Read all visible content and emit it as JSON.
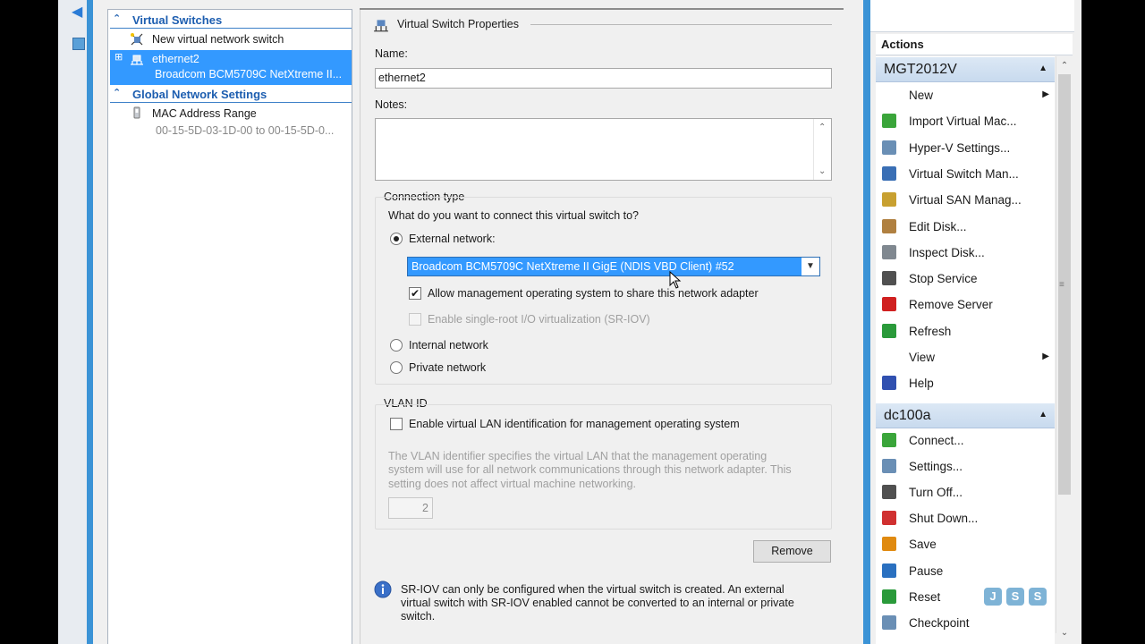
{
  "tree": {
    "sections": [
      {
        "label": "Virtual Switches"
      },
      {
        "label": "Global Network Settings"
      }
    ],
    "new_switch": "New virtual network switch",
    "switch": {
      "name": "ethernet2",
      "adapter": "Broadcom BCM5709C NetXtreme II..."
    },
    "mac": {
      "label": "MAC Address Range",
      "value": "00-15-5D-03-1D-00 to 00-15-5D-0..."
    }
  },
  "props": {
    "title": "Virtual Switch Properties",
    "name_label": "Name:",
    "name_value": "ethernet2",
    "notes_label": "Notes:",
    "connection": {
      "title": "Connection type",
      "question": "What do you want to connect this virtual switch to?",
      "external": "External network:",
      "adapter_selected": "Broadcom BCM5709C NetXtreme II GigE (NDIS VBD Client) #52",
      "allow_mgmt": "Allow management operating system to share this network adapter",
      "sriov": "Enable single-root I/O virtualization (SR-IOV)",
      "internal": "Internal network",
      "private": "Private network"
    },
    "vlan": {
      "title": "VLAN ID",
      "enable": "Enable virtual LAN identification for management operating system",
      "desc1": "The VLAN identifier specifies the virtual LAN that the management operating",
      "desc2": "system will use for all network communications through this network adapter. This",
      "desc3": "setting does not affect virtual machine networking.",
      "value": "2"
    },
    "remove_button": "Remove",
    "info1": "SR-IOV can only be configured when the virtual switch is created. An external",
    "info2": "virtual switch with SR-IOV enabled cannot be converted to an internal or private",
    "info3": "switch."
  },
  "actions": {
    "header": "Actions",
    "group1": {
      "title": "MGT2012V",
      "items": [
        {
          "label": "New",
          "icon": "none",
          "color": ""
        },
        {
          "label": "Import Virtual Mac...",
          "icon": "import-icon",
          "color": "#3aa53a"
        },
        {
          "label": "Hyper-V Settings...",
          "icon": "settings-icon",
          "color": "#6a8fb5"
        },
        {
          "label": "Virtual Switch Man...",
          "icon": "network-icon",
          "color": "#3a6fb5"
        },
        {
          "label": "Virtual SAN Manag...",
          "icon": "san-icon",
          "color": "#c8a030"
        },
        {
          "label": "Edit Disk...",
          "icon": "edit-disk-icon",
          "color": "#b08040"
        },
        {
          "label": "Inspect Disk...",
          "icon": "inspect-disk-icon",
          "color": "#808890"
        },
        {
          "label": "Stop Service",
          "icon": "stop-icon",
          "color": "#505050"
        },
        {
          "label": "Remove Server",
          "icon": "remove-icon",
          "color": "#d02020"
        },
        {
          "label": "Refresh",
          "icon": "refresh-icon",
          "color": "#2a9a3a"
        },
        {
          "label": "View",
          "icon": "none",
          "color": ""
        },
        {
          "label": "Help",
          "icon": "help-icon",
          "color": "#3050b0"
        }
      ]
    },
    "group2": {
      "title": "dc100a",
      "items": [
        {
          "label": "Connect...",
          "icon": "connect-icon",
          "color": "#3aa53a"
        },
        {
          "label": "Settings...",
          "icon": "settings-icon",
          "color": "#6a8fb5"
        },
        {
          "label": "Turn Off...",
          "icon": "turn-off-icon",
          "color": "#505050"
        },
        {
          "label": "Shut Down...",
          "icon": "shutdown-icon",
          "color": "#d03030"
        },
        {
          "label": "Save",
          "icon": "save-icon",
          "color": "#e08a10"
        },
        {
          "label": "Pause",
          "icon": "pause-icon",
          "color": "#2a70c0"
        },
        {
          "label": "Reset",
          "icon": "reset-icon",
          "color": "#2a9a3a"
        },
        {
          "label": "Checkpoint",
          "icon": "checkpoint-icon",
          "color": "#6a8fb5"
        }
      ]
    }
  },
  "watermark": [
    "J",
    "S",
    "S"
  ]
}
